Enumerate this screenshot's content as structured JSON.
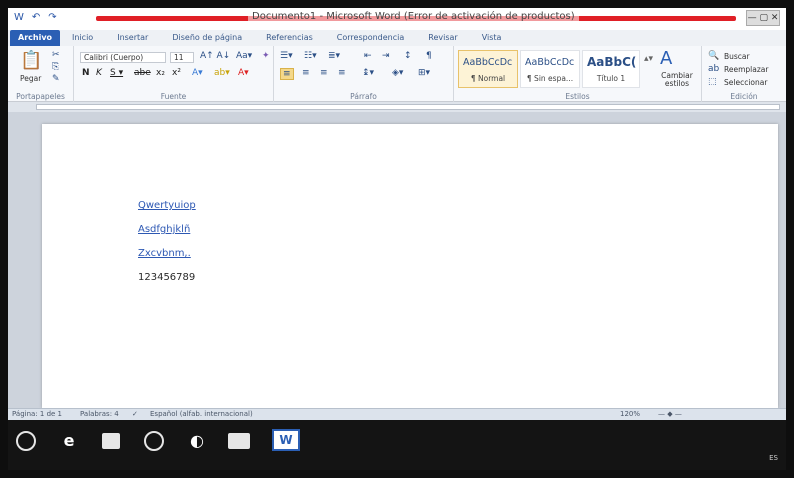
{
  "titlebar": {
    "title": "Documento1 - Microsoft Word (Error de activación de productos)",
    "quick_access": [
      "W",
      "↶",
      "↷"
    ]
  },
  "tabs": [
    "Archivo",
    "Inicio",
    "Insertar",
    "Diseño de página",
    "Referencias",
    "Correspondencia",
    "Revisar",
    "Vista"
  ],
  "ribbon": {
    "clipboard": {
      "paste": "Pegar",
      "label": "Portapapeles"
    },
    "font": {
      "name": "Calibri (Cuerpo)",
      "size": "11",
      "label": "Fuente"
    },
    "paragraph": {
      "label": "Párrafo"
    },
    "styles": {
      "items": [
        {
          "sample": "AaBbCcDc",
          "name": "¶ Normal"
        },
        {
          "sample": "AaBbCcDc",
          "name": "¶ Sin espa..."
        },
        {
          "sample": "AaBbC(",
          "name": "Título 1"
        }
      ],
      "change": "Cambiar estilos",
      "label": "Estilos"
    },
    "editing": {
      "find": "Buscar",
      "replace": "Reemplazar",
      "select": "Seleccionar",
      "label": "Edición"
    }
  },
  "document": {
    "lines": [
      "Qwertyuiop",
      "Asdfghjklñ",
      "Zxcvbnm,.",
      "123456789"
    ]
  },
  "status": {
    "page": "Página: 1 de 1",
    "words": "Palabras: 4",
    "language": "Español (alfab. internacional)",
    "zoom": "120%"
  },
  "tray": {
    "lang": "ES"
  }
}
